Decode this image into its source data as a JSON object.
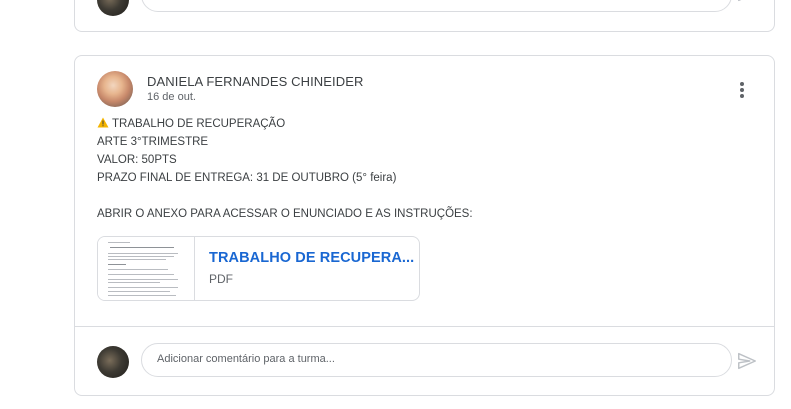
{
  "previous_post": {
    "comment_placeholder": "Adicionar comentário para a turma..."
  },
  "post": {
    "author": "DANIELA FERNANDES CHINEIDER",
    "date": "16 de out.",
    "more_options_icon": "more-vert-icon",
    "lines": [
      "TRABALHO DE RECUPERAÇÃO",
      "ARTE 3°TRIMESTRE",
      "VALOR: 50PTS",
      "PRAZO FINAL DE ENTREGA: 31 DE OUTUBRO (5° feira)",
      "",
      "ABRIR O ANEXO PARA ACESSAR O ENUNCIADO E AS INSTRUÇÕES:"
    ],
    "warning_icon": "warning-icon",
    "attachment": {
      "title": "TRABALHO DE RECUPERA...",
      "type": "PDF"
    },
    "comment_placeholder": "Adicionar comentário para a turma...",
    "send_icon": "send-icon"
  },
  "colors": {
    "link_blue": "#1967d2",
    "border": "#dadce0",
    "text": "#3c4043",
    "muted": "#5f6368"
  }
}
